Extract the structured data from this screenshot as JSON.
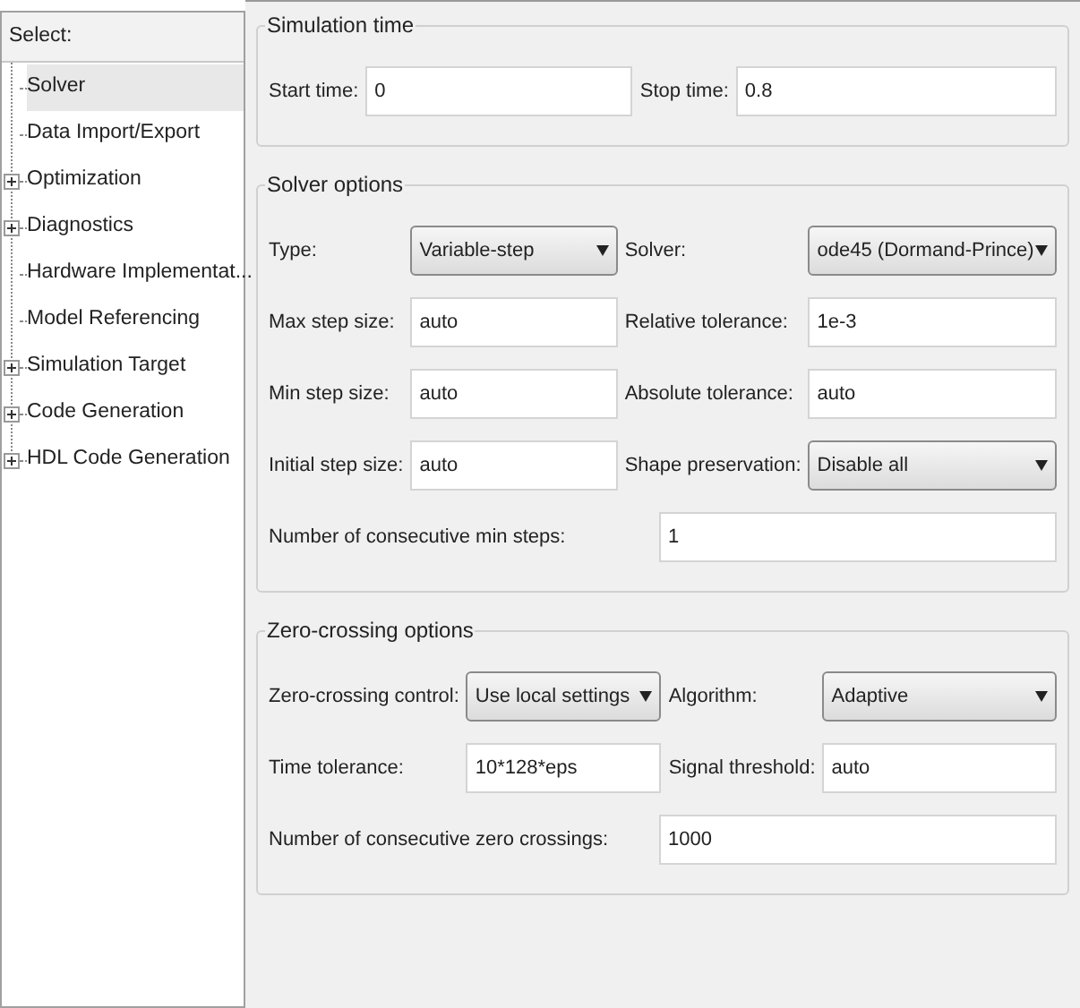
{
  "sidebar": {
    "header": "Select:",
    "items": [
      {
        "label": "Solver",
        "expandable": false,
        "selected": true
      },
      {
        "label": "Data Import/Export",
        "expandable": false,
        "selected": false
      },
      {
        "label": "Optimization",
        "expandable": true,
        "selected": false
      },
      {
        "label": "Diagnostics",
        "expandable": true,
        "selected": false
      },
      {
        "label": "Hardware Implementat...",
        "expandable": false,
        "selected": false
      },
      {
        "label": "Model Referencing",
        "expandable": false,
        "selected": false
      },
      {
        "label": "Simulation Target",
        "expandable": true,
        "selected": false
      },
      {
        "label": "Code Generation",
        "expandable": true,
        "selected": false
      },
      {
        "label": "HDL Code Generation",
        "expandable": true,
        "selected": false
      }
    ]
  },
  "sections": [
    {
      "title": "Simulation time",
      "rows": [
        [
          {
            "label": "Start time:",
            "value": "0",
            "kind": "text"
          },
          {
            "label": "Stop time:",
            "value": "0.8",
            "kind": "text"
          }
        ]
      ]
    },
    {
      "title": "Solver options",
      "rows": [
        [
          {
            "label": "Type:",
            "value": "Variable-step",
            "kind": "dropdown"
          },
          {
            "label": "Solver:",
            "value": "ode45 (Dormand-Prince)",
            "kind": "dropdown"
          }
        ],
        [
          {
            "label": "Max step size:",
            "value": "auto",
            "kind": "text"
          },
          {
            "label": "Relative tolerance:",
            "value": "1e-3",
            "kind": "text"
          }
        ],
        [
          {
            "label": "Min step size:",
            "value": "auto",
            "kind": "text"
          },
          {
            "label": "Absolute tolerance:",
            "value": "auto",
            "kind": "text"
          }
        ],
        [
          {
            "label": "Initial step size:",
            "value": "auto",
            "kind": "text"
          },
          {
            "label": "Shape preservation:",
            "value": "Disable all",
            "kind": "dropdown"
          }
        ],
        [
          {
            "label": "Number of consecutive min steps:",
            "value": "1",
            "kind": "wide"
          }
        ]
      ]
    },
    {
      "title": "Zero-crossing options",
      "rows": [
        [
          {
            "label": "Zero-crossing control:",
            "value": "Use local settings",
            "kind": "dropdown"
          },
          {
            "label": "Algorithm:",
            "value": "Adaptive",
            "kind": "dropdown"
          }
        ],
        [
          {
            "label": "Time tolerance:",
            "value": "10*128*eps",
            "kind": "text"
          },
          {
            "label": "Signal threshold:",
            "value": "auto",
            "kind": "text"
          }
        ],
        [
          {
            "label": "Number of consecutive zero crossings:",
            "value": "1000",
            "kind": "wide"
          }
        ]
      ]
    }
  ]
}
